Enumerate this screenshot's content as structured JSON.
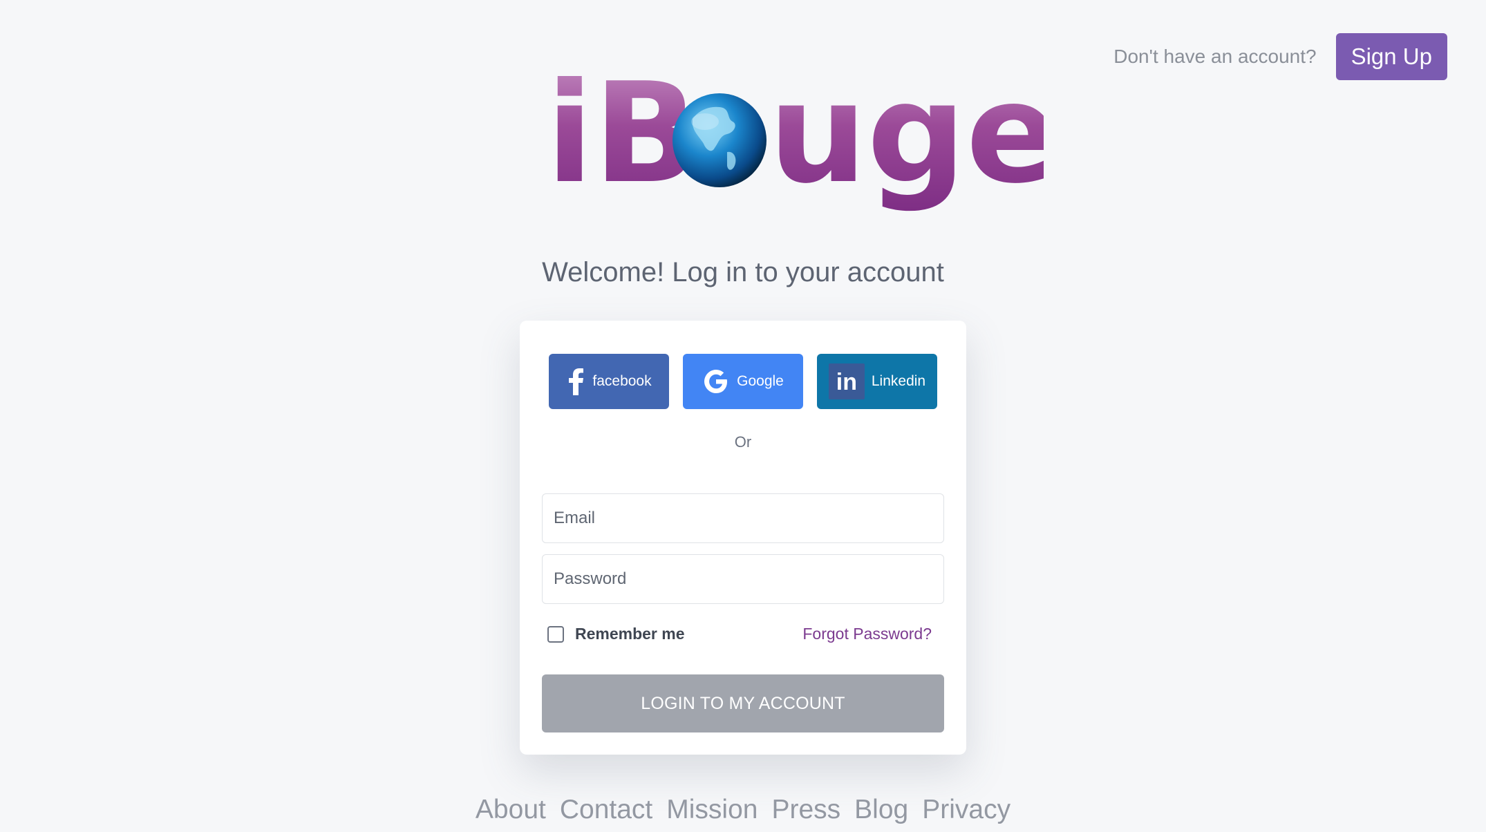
{
  "header": {
    "prompt": "Don't have an account?",
    "signup_label": "Sign Up"
  },
  "logo": {
    "text_left": "iB",
    "text_right": "uge",
    "icon": "globe-icon"
  },
  "welcome": "Welcome! Log in to your account",
  "social": {
    "facebook_label": "facebook",
    "google_label": "Google",
    "linkedin_label": "Linkedin",
    "linkedin_icon_text": "in"
  },
  "or_text": "Or",
  "form": {
    "email_placeholder": "Email",
    "password_placeholder": "Password",
    "remember_label": "Remember me",
    "forgot_label": "Forgot Password?",
    "login_label": "LOGIN TO MY ACCOUNT"
  },
  "footer": {
    "links": [
      "About",
      "Contact",
      "Mission",
      "Press",
      "Blog",
      "Privacy"
    ]
  },
  "colors": {
    "brand_purple": "#7b5bb1",
    "logo_purple": "#8a3a8e",
    "facebook": "#4267b2",
    "google": "#4285f4",
    "linkedin": "#0e76a8",
    "login_button": "#a1a5ad"
  }
}
